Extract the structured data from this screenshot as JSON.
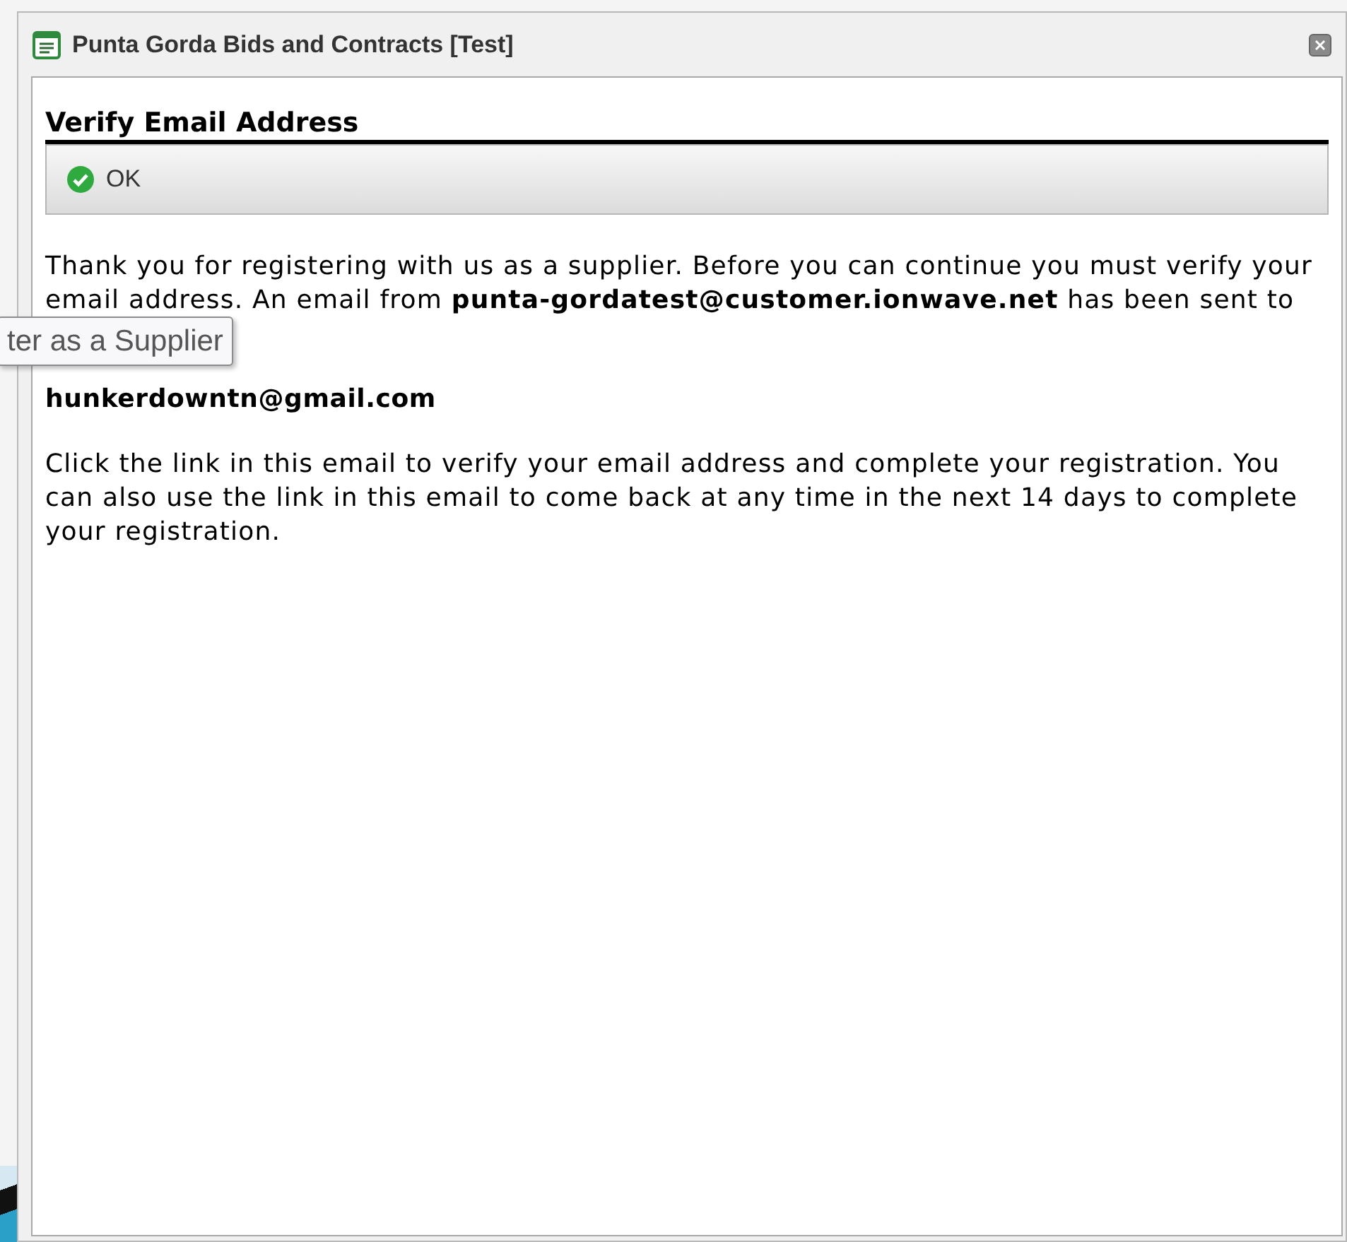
{
  "window": {
    "title": "Punta Gorda Bids and Contracts [Test]"
  },
  "section": {
    "heading": "Verify Email Address"
  },
  "toolbar": {
    "buttons": [
      {
        "label": "OK"
      }
    ]
  },
  "message": {
    "paragraphs": [
      {
        "kind": "text",
        "text": "Thank you for registering with us as a supplier. Before you can continue you must verify your email address. An email from **punta-gordatest@customer.ionwave.net** has been sent to"
      },
      {
        "kind": "email",
        "text": "hunkerdowntn@gmail.com"
      },
      {
        "kind": "text",
        "text": "Click the link in this email to verify your email address and complete your registration. You can also use the link in this email to come back at any time in the next 14 days to complete your registration."
      }
    ]
  },
  "tooltip": {
    "text": "ter as a Supplier"
  }
}
